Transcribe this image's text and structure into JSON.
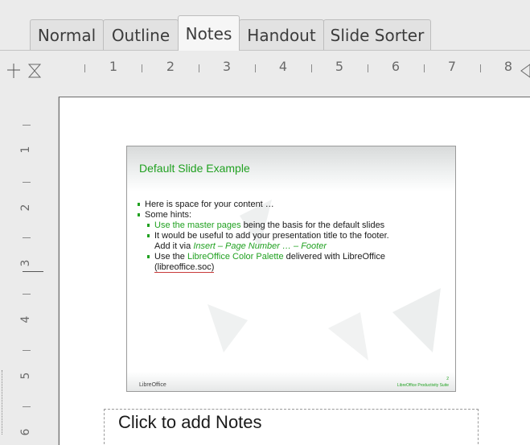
{
  "tabs": [
    {
      "label": "Normal",
      "active": false
    },
    {
      "label": "Outline",
      "active": false
    },
    {
      "label": "Notes",
      "active": true
    },
    {
      "label": "Handout",
      "active": false
    },
    {
      "label": "Slide Sorter",
      "active": false
    }
  ],
  "hruler": {
    "labels": [
      "1",
      "2",
      "3",
      "4",
      "5",
      "6",
      "7",
      "8"
    ]
  },
  "vruler": {
    "labels": [
      "1",
      "2",
      "3",
      "4",
      "5",
      "6"
    ]
  },
  "slide": {
    "title": "Default Slide Example",
    "bullets": {
      "b1": "Here is space for your content …",
      "b2": "Some hints:",
      "b3_link": "Use the master pages",
      "b3_rest": " being the basis for the default slides",
      "b4_line1": "It would be useful to add your presentation title to the footer.",
      "b4_line2_pre": "Add it via ",
      "b4_line2_link": "Insert – Page Number … – Footer",
      "b5_pre": "Use the ",
      "b5_link": "LibreOffice Color Palette",
      "b5_rest": " delivered with LibreOffice",
      "b5_line2": "(libreoffice.soc)"
    },
    "footer_logo": "LibreOffice",
    "footer_right": "LibreOffice Productivity Suite",
    "page_number": "2"
  },
  "notes_placeholder": "Click to add Notes",
  "colors": {
    "accent": "#21a121",
    "background": "#ebebeb",
    "page": "#ffffff"
  }
}
